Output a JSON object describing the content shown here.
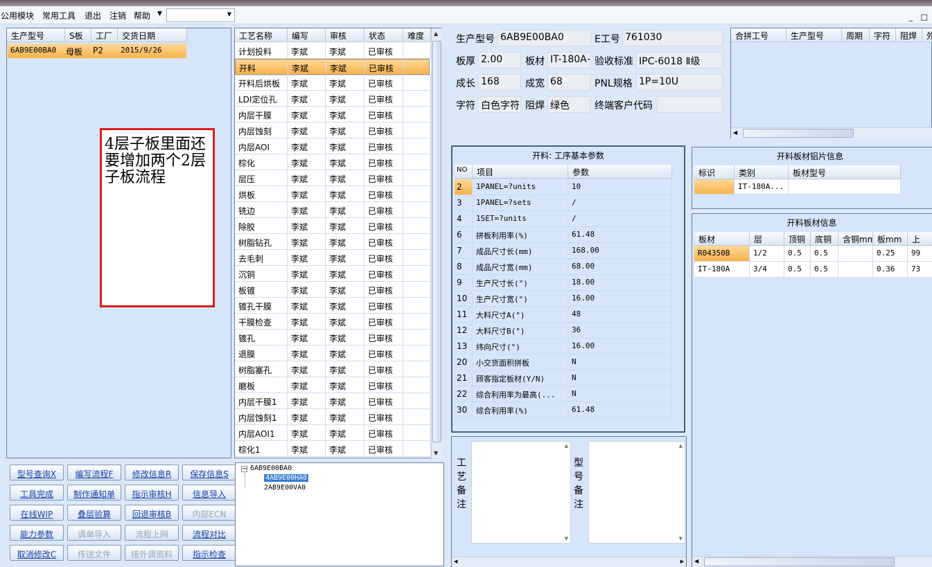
{
  "menu": {
    "items": [
      "公用模块",
      "常用工具",
      "退出",
      "注销",
      "帮助"
    ],
    "combo_value": ""
  },
  "window_controls": "_ □",
  "product_list": {
    "columns": [
      "生产型号",
      "S板",
      "工厂",
      "交货日期"
    ],
    "rows": [
      [
        "6AB9E00BA0",
        "母板",
        "P2",
        "2015/9/26"
      ]
    ]
  },
  "annotation": "4层子板里面还要增加两个2层子板流程",
  "process_table": {
    "columns": [
      "工艺名称",
      "编写",
      "审核",
      "状态",
      "难度"
    ],
    "rows": [
      [
        "计划投料",
        "李斌",
        "李斌",
        "已审核"
      ],
      [
        "开料",
        "李斌",
        "李斌",
        "已审核"
      ],
      [
        "开料后烘板",
        "李斌",
        "李斌",
        "已审核"
      ],
      [
        "LDI定位孔",
        "李斌",
        "李斌",
        "已审核"
      ],
      [
        "内层干膜",
        "李斌",
        "李斌",
        "已审核"
      ],
      [
        "内层蚀刻",
        "李斌",
        "李斌",
        "已审核"
      ],
      [
        "内层AOI",
        "李斌",
        "李斌",
        "已审核"
      ],
      [
        "棕化",
        "李斌",
        "李斌",
        "已审核"
      ],
      [
        "层压",
        "李斌",
        "李斌",
        "已审核"
      ],
      [
        "烘板",
        "李斌",
        "李斌",
        "已审核"
      ],
      [
        "铣边",
        "李斌",
        "李斌",
        "已审核"
      ],
      [
        "除胶",
        "李斌",
        "李斌",
        "已审核"
      ],
      [
        "树脂钻孔",
        "李斌",
        "李斌",
        "已审核"
      ],
      [
        "去毛刺",
        "李斌",
        "李斌",
        "已审核"
      ],
      [
        "沉铜",
        "李斌",
        "李斌",
        "已审核"
      ],
      [
        "板镀",
        "李斌",
        "李斌",
        "已审核"
      ],
      [
        "镀孔干膜",
        "李斌",
        "李斌",
        "已审核"
      ],
      [
        "干膜检查",
        "李斌",
        "李斌",
        "已审核"
      ],
      [
        "镀孔",
        "李斌",
        "李斌",
        "已审核"
      ],
      [
        "退膜",
        "李斌",
        "李斌",
        "已审核"
      ],
      [
        "树脂塞孔",
        "李斌",
        "李斌",
        "已审核"
      ],
      [
        "磨板",
        "李斌",
        "李斌",
        "已审核"
      ],
      [
        "内层干膜1",
        "李斌",
        "李斌",
        "已审核"
      ],
      [
        "内层蚀刻1",
        "李斌",
        "李斌",
        "已审核"
      ],
      [
        "内层AOI1",
        "李斌",
        "李斌",
        "已审核"
      ],
      [
        "棕化1",
        "李斌",
        "李斌",
        "已审核"
      ]
    ]
  },
  "buttons": [
    [
      "型号查询X",
      "编写流程F",
      "修改信息R",
      "保存信息S"
    ],
    [
      "工具完成",
      "制作通知单",
      "指示审核H",
      "信息导入"
    ],
    [
      "在线WIP",
      "叠层验算",
      "回退审核B",
      "内部ECN"
    ],
    [
      "能力参数",
      "调单导入",
      "流程上网",
      "流程对比"
    ],
    [
      "取消修改C",
      "传送文件",
      "接外调资料",
      "指示检查"
    ]
  ],
  "buttons_disabled": [
    [
      false,
      false,
      false,
      false
    ],
    [
      false,
      false,
      false,
      false
    ],
    [
      false,
      false,
      false,
      true
    ],
    [
      false,
      true,
      true,
      false
    ],
    [
      false,
      true,
      true,
      false
    ]
  ],
  "tree": {
    "root": "6AB9E00BA0",
    "children": [
      "4AB9E00HA0",
      "2AB9E00VA0"
    ]
  },
  "info": {
    "prod_model_label": "生产型号",
    "prod_model": "6AB9E00BA0",
    "e_no_label": "E工号",
    "e_no": "761030",
    "thickness_label": "板厚",
    "thickness": "2.00",
    "material_label": "板材",
    "material": "IT-180A+",
    "std_label": "验收标准",
    "std": "IPC-6018 Ⅱ级",
    "len_label": "成长",
    "len": "168",
    "wid_label": "成宽",
    "wid": "68",
    "pnl_label": "PNL规格",
    "pnl": "1P=10U",
    "char_label": "字符",
    "char": "白色字符",
    "mask_label": "阻焊",
    "mask": "绿色",
    "cust_label": "终端客户代码",
    "cust": ""
  },
  "combine_table": {
    "columns": [
      "合拼工号",
      "生产型号",
      "周期",
      "字符",
      "阻焊",
      "外"
    ]
  },
  "params": {
    "title": "开料: 工序基本参数",
    "columns": [
      "NO",
      "项目",
      "参数"
    ],
    "rows": [
      [
        "2",
        "1PANEL=?units",
        "10"
      ],
      [
        "3",
        "1PANEL=?sets",
        "/"
      ],
      [
        "4",
        "1SET=?units",
        "/"
      ],
      [
        "6",
        "拼板利用率(%)",
        "61.48"
      ],
      [
        "7",
        "成品尺寸长(mm)",
        "168.00"
      ],
      [
        "8",
        "成品尺寸宽(mm)",
        "68.00"
      ],
      [
        "9",
        "生产尺寸长(\")",
        "18.00"
      ],
      [
        "10",
        "生产尺寸宽(\")",
        "16.00"
      ],
      [
        "11",
        "大料尺寸A(\")",
        "48"
      ],
      [
        "12",
        "大料尺寸B(\")",
        "36"
      ],
      [
        "13",
        "纬向尺寸(\")",
        "16.00"
      ],
      [
        "20",
        "小交货面积拼板",
        "N"
      ],
      [
        "21",
        "顾客指定板材(Y/N)",
        "N"
      ],
      [
        "22",
        "综合利用率为最高(...",
        "N"
      ],
      [
        "30",
        "综合利用率(%)",
        "61.48"
      ]
    ]
  },
  "al_sheet": {
    "title": "开料板材铝片信息",
    "columns": [
      "标识",
      "类别",
      "板材型号"
    ],
    "rows": [
      [
        "",
        "IT-180A...",
        ""
      ]
    ]
  },
  "board_info": {
    "title": "开料板材信息",
    "columns": [
      "板材",
      "层",
      "顶铜",
      "底铜",
      "含铜mm",
      "板mm",
      "上"
    ],
    "rows": [
      [
        "R04350B",
        "1/2",
        "0.5",
        "0.5",
        "",
        "0.25",
        "99"
      ],
      [
        "IT-180A",
        "3/4",
        "0.5",
        "0.5",
        "",
        "0.36",
        "73"
      ]
    ]
  },
  "remarks": {
    "process_label": "工艺备注",
    "model_label": "型号备注"
  }
}
